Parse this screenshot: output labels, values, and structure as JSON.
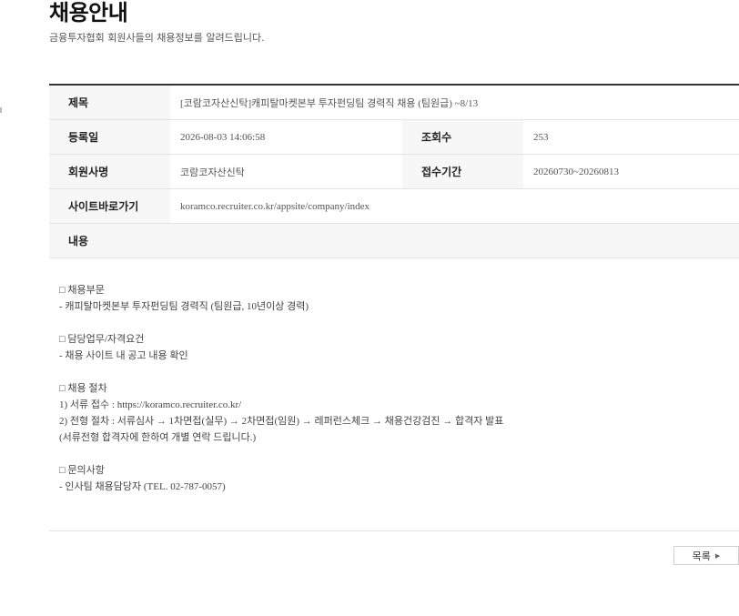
{
  "header": {
    "title": "채용안내",
    "subtitle": "금융투자협회 회원사들의 채용정보를 알려드립니다."
  },
  "detail": {
    "title_label": "제목",
    "title_value": "[코람코자산신탁]캐피탈마켓본부 투자펀딩팀 경력직 채용 (팀원급) ~8/13",
    "date_label": "등록일",
    "date_value": "2026-08-03 14:06:58",
    "views_label": "조회수",
    "views_value": "253",
    "company_label": "회원사명",
    "company_value": "코람코자산신탁",
    "period_label": "접수기간",
    "period_value": "20260730~20260813",
    "site_label": "사이트바로가기",
    "site_value": "koramco.recruiter.co.kr/appsite/company/index",
    "content_label": "내용"
  },
  "content": {
    "lines": [
      "□ 채용부문",
      "- 캐피탈마켓본부 투자펀딩팀 경력직 (팀원급, 10년이상 경력)",
      "",
      "□ 담당업무/자격요건",
      "- 채용 사이트 내 공고 내용 확인",
      "",
      "□ 채용 절차",
      "1) 서류 접수 : https://koramco.recruiter.co.kr/",
      "2) 전형 절차 : 서류심사 → 1차면접(실무) → 2차면접(임원) → 레퍼런스체크 → 채용건강검진 → 합격자 발표",
      "(서류전형 합격자에 한하여 개별 연락 드립니다.)",
      "",
      "□ 문의사항",
      "- 인사팀 채용담당자 (TEL. 02-787-0057)"
    ]
  },
  "footer": {
    "list_button_label": "목록",
    "list_button_icon": "arrow-right-icon"
  }
}
